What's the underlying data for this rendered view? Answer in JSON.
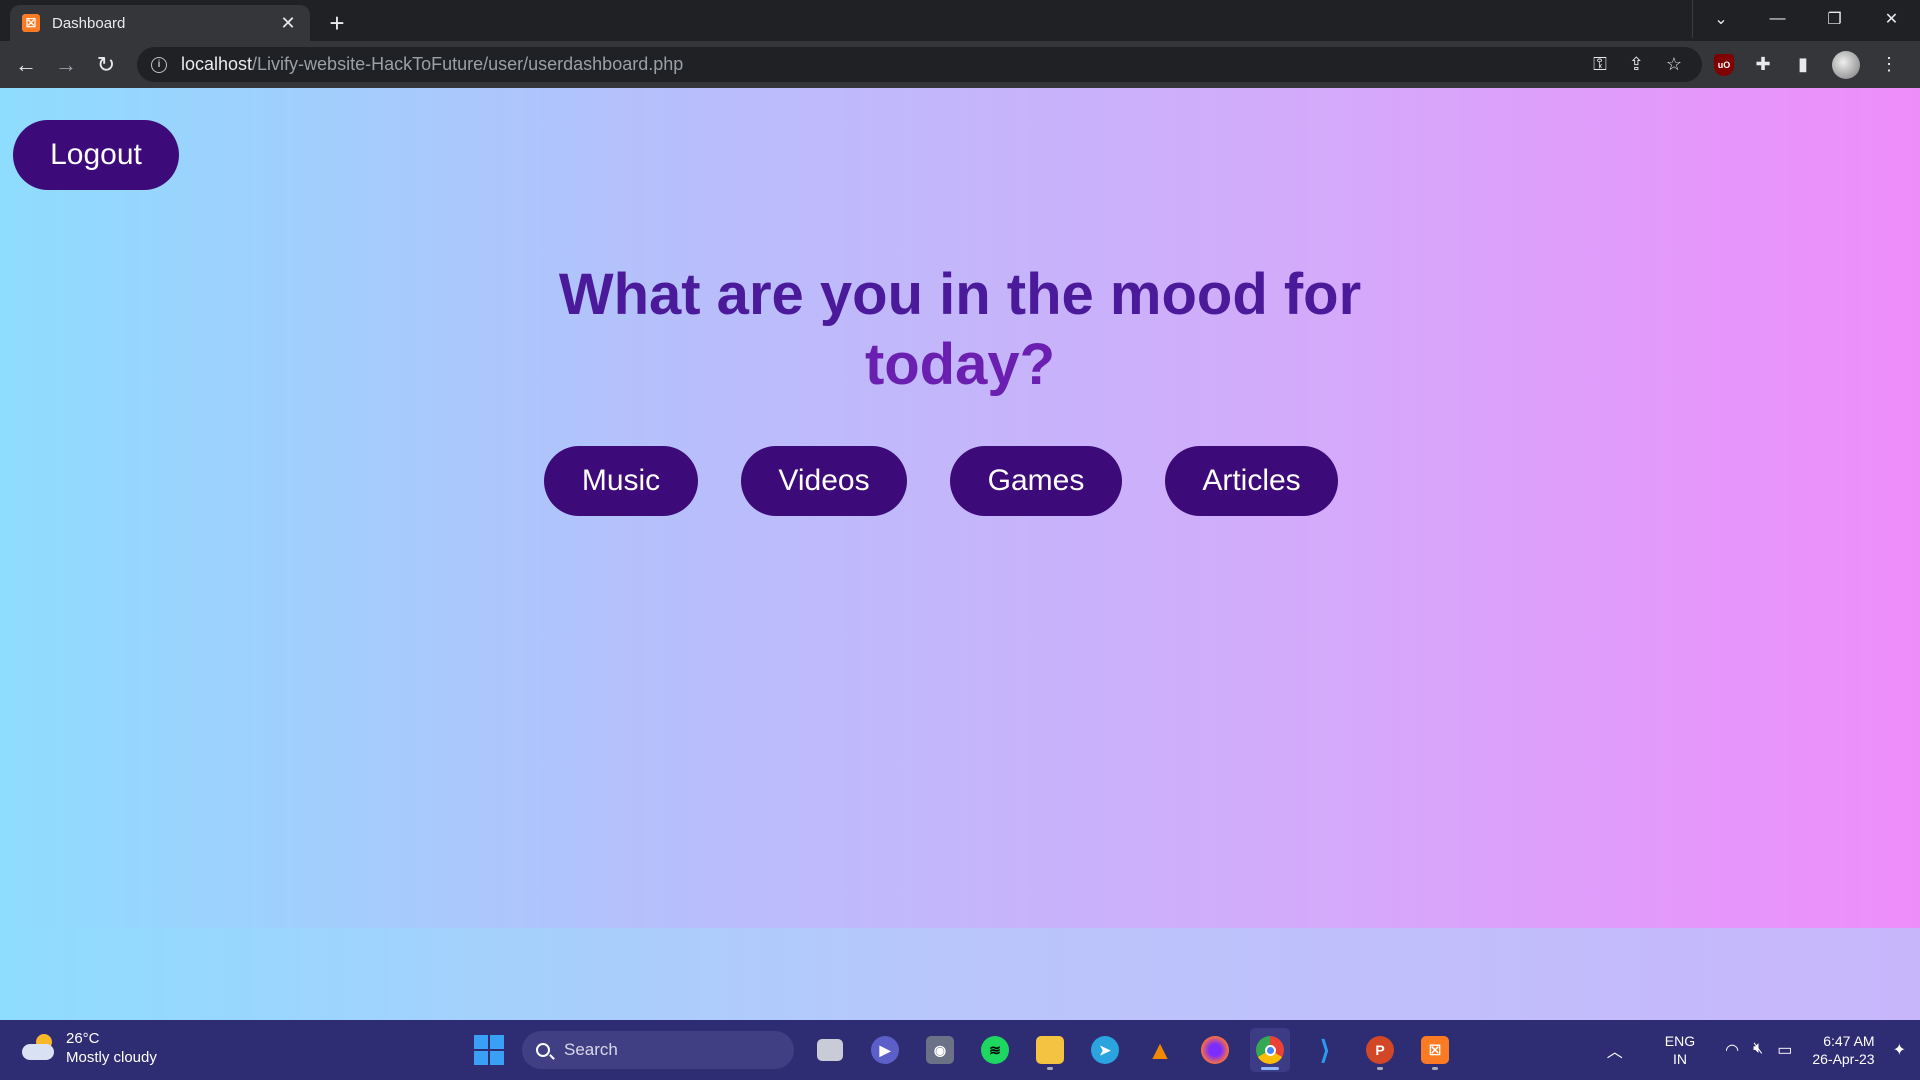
{
  "browser": {
    "tab": {
      "title": "Dashboard",
      "favicon_icon": "xampp-icon",
      "close_icon": "close-icon"
    },
    "new_tab_icon": "plus-icon",
    "window_controls": [
      "chevron-down-icon",
      "minimize-icon",
      "restore-icon",
      "close-icon"
    ],
    "nav": [
      "back-icon",
      "forward-icon",
      "reload-icon"
    ],
    "url": {
      "host": "localhost",
      "path": "/Livify-website-HackToFuture/user/userdashboard.php"
    },
    "omnibox_icons": [
      "key-icon",
      "share-icon",
      "star-icon"
    ],
    "extensions": [
      "ublock-icon",
      "puzzle-icon",
      "sidepanel-icon",
      "profile-avatar",
      "more-icon"
    ]
  },
  "page": {
    "logout_label": "Logout",
    "headline_line1": "What are you in the mood for",
    "headline_line2": "today?",
    "choices": [
      "Music",
      "Videos",
      "Games",
      "Articles"
    ],
    "colors": {
      "button_bg": "#3d0a7a",
      "headline": "#4b1a9a",
      "gradient_start": "#8edcfe",
      "gradient_end": "#ee8dfa"
    }
  },
  "taskbar": {
    "weather": {
      "temp": "26°C",
      "desc": "Mostly cloudy"
    },
    "search_placeholder": "Search",
    "apps": [
      "taskview",
      "meet",
      "camera",
      "spotify",
      "explorer",
      "telegram",
      "vlc",
      "firefox",
      "chrome",
      "vscode",
      "powerpoint",
      "xampp"
    ],
    "lang": {
      "line1": "ENG",
      "line2": "IN"
    },
    "clock": {
      "time": "6:47 AM",
      "date": "26-Apr-23"
    }
  }
}
